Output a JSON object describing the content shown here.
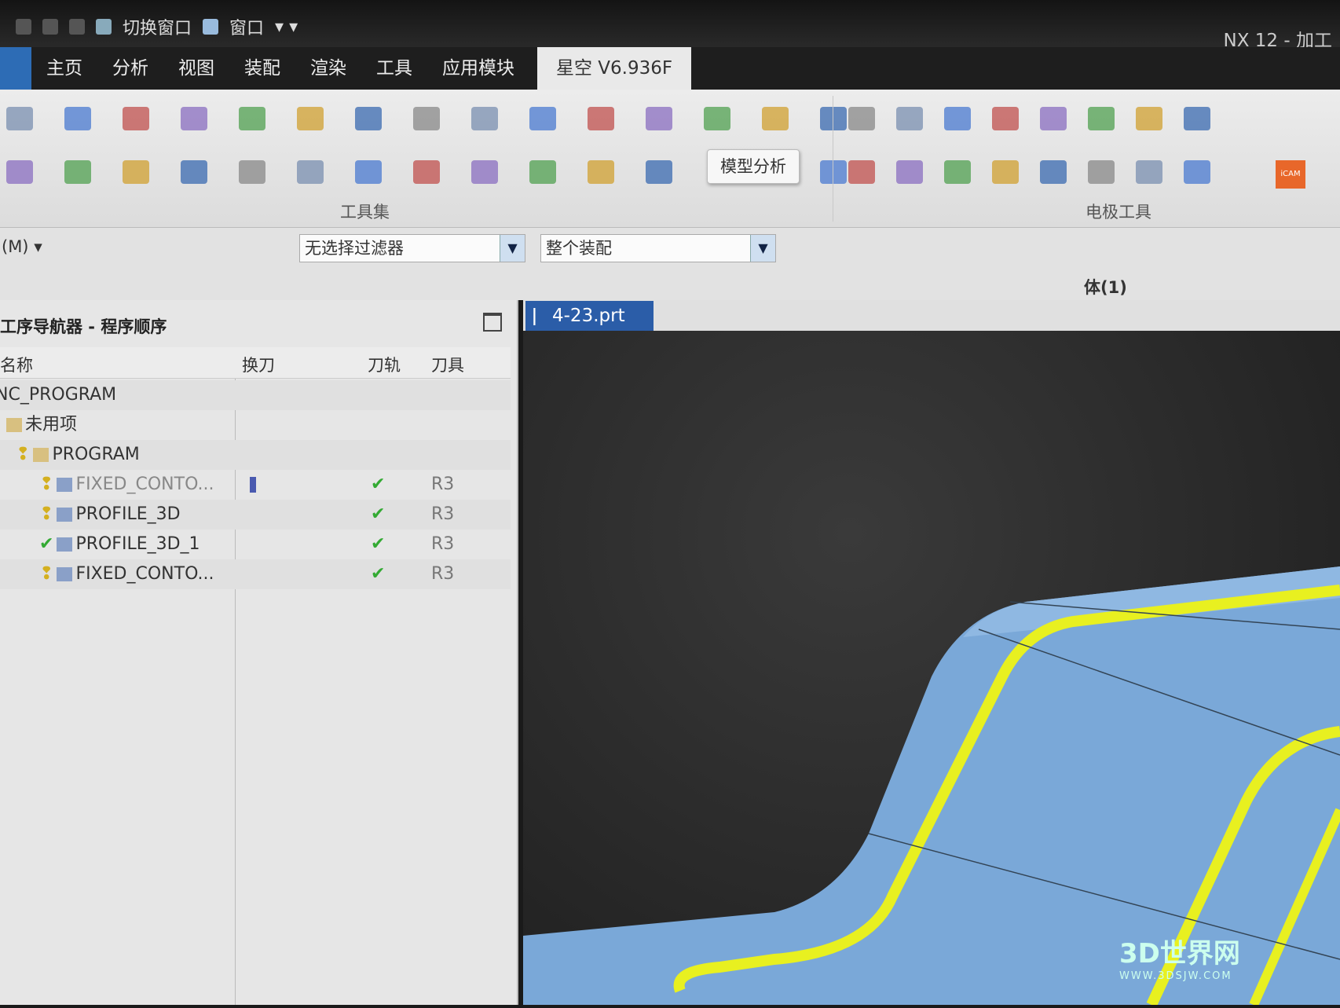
{
  "window": {
    "title": "NX 12 - 加工",
    "quick_access": [
      "切换窗口",
      "窗口"
    ]
  },
  "tabs": [
    "主页",
    "分析",
    "视图",
    "装配",
    "渲染",
    "工具",
    "应用模块",
    "星空 V6.936F"
  ],
  "active_tab": "星空 V6.936F",
  "ribbon": {
    "groups": [
      "工具集",
      "电极工具"
    ],
    "tooltip": "模型分析",
    "cam_icon_label": "iCAM"
  },
  "selection_bar": {
    "menu_label": "(M)",
    "filter": "无选择过滤器",
    "scope": "整个装配",
    "selection_count": "体(1)"
  },
  "navigator": {
    "title": "工序导航器 - 程序顺序",
    "columns": [
      "名称",
      "换刀",
      "刀轨",
      "刀具"
    ],
    "rows": [
      {
        "name": "NC_PROGRAM",
        "level": 0,
        "status": "",
        "tool_change": "",
        "path": "",
        "tool": ""
      },
      {
        "name": "未用项",
        "level": 1,
        "status": "",
        "tool_change": "",
        "path": "",
        "tool": ""
      },
      {
        "name": "PROGRAM",
        "level": 1,
        "status": "warning",
        "tool_change": "",
        "path": "",
        "tool": ""
      },
      {
        "name": "FIXED_CONTO...",
        "level": 2,
        "status": "warning",
        "tool_change": "tool-change-icon",
        "path": "✔",
        "tool": "R3"
      },
      {
        "name": "PROFILE_3D",
        "level": 2,
        "status": "warning",
        "tool_change": "",
        "path": "✔",
        "tool": "R3"
      },
      {
        "name": "PROFILE_3D_1",
        "level": 2,
        "status": "ok",
        "tool_change": "",
        "path": "✔",
        "tool": "R3"
      },
      {
        "name": "FIXED_CONTO...",
        "level": 2,
        "status": "warning",
        "tool_change": "",
        "path": "✔",
        "tool": "R3"
      }
    ]
  },
  "viewport": {
    "tab_label": "4-23.prt",
    "close": "×",
    "model_color": "#7aa8d8",
    "highlight_color": "#e8f020"
  },
  "watermark": {
    "name": "3D世界网",
    "url": "WWW.3DSJW.COM"
  }
}
